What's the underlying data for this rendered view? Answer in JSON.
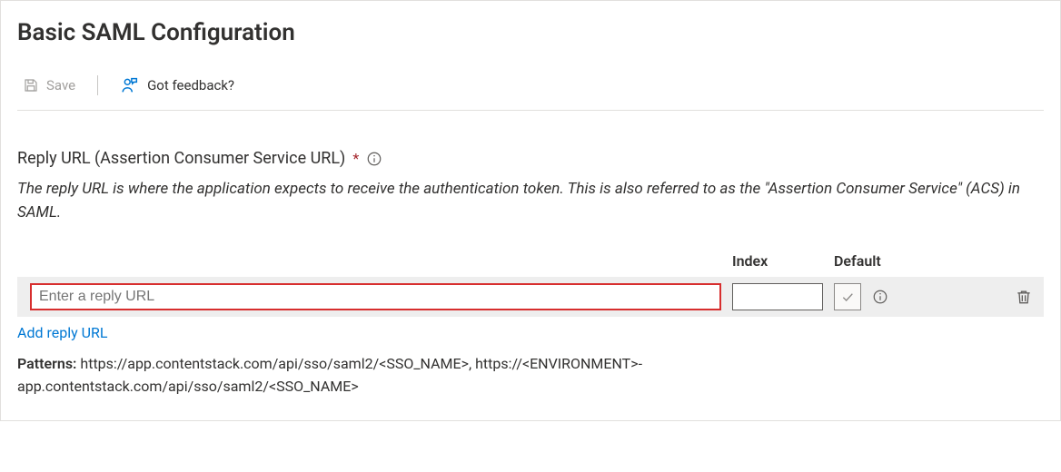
{
  "page_title": "Basic SAML Configuration",
  "toolbar": {
    "save_label": "Save",
    "feedback_label": "Got feedback?"
  },
  "section": {
    "label": "Reply URL (Assertion Consumer Service URL)",
    "required_marker": "*",
    "description": "The reply URL is where the application expects to receive the authentication token. This is also referred to as the \"Assertion Consumer Service\" (ACS) in SAML."
  },
  "columns": {
    "index": "Index",
    "default": "Default"
  },
  "row": {
    "reply_placeholder": "Enter a reply URL",
    "reply_value": "",
    "index_value": ""
  },
  "add_link_label": "Add reply URL",
  "patterns_label": "Patterns:",
  "patterns_value": "https://app.contentstack.com/api/sso/saml2/<SSO_NAME>, https://<ENVIRONMENT>-app.contentstack.com/api/sso/saml2/<SSO_NAME>"
}
